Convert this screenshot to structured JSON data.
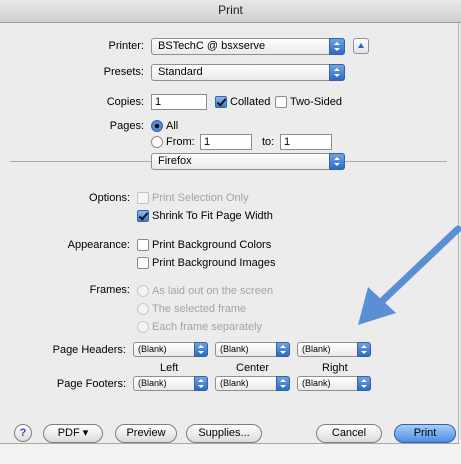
{
  "window": {
    "title": "Print"
  },
  "printer": {
    "label": "Printer:",
    "value": "BSTechC @ bsxserve"
  },
  "presets": {
    "label": "Presets:",
    "value": "Standard"
  },
  "copies": {
    "label": "Copies:",
    "value": "1",
    "collated_label": "Collated",
    "two_sided_label": "Two-Sided"
  },
  "pages": {
    "label": "Pages:",
    "all_label": "All",
    "from_label": "From:",
    "from_value": "1",
    "to_label": "to:",
    "to_value": "1"
  },
  "section": {
    "value": "Firefox"
  },
  "options": {
    "label": "Options:",
    "print_selection_only": "Print Selection Only",
    "shrink_to_fit": "Shrink To Fit Page Width"
  },
  "appearance": {
    "label": "Appearance:",
    "print_bg_colors": "Print Background Colors",
    "print_bg_images": "Print Background Images"
  },
  "frames": {
    "label": "Frames:",
    "as_laid_out": "As laid out on the screen",
    "selected_frame": "The selected frame",
    "each_frame": "Each frame separately"
  },
  "headers": {
    "label": "Page Headers:",
    "left": "(Blank)",
    "center": "(Blank)",
    "right": "(Blank)"
  },
  "columns": {
    "left": "Left",
    "center": "Center",
    "right": "Right"
  },
  "footers": {
    "label": "Page Footers:",
    "left": "(Blank)",
    "center": "(Blank)",
    "right": "(Blank)"
  },
  "buttons": {
    "help": "?",
    "pdf": "PDF ▾",
    "preview": "Preview",
    "supplies": "Supplies...",
    "cancel": "Cancel",
    "print": "Print"
  },
  "annotation": {
    "arrow_color": "#5b8fd4"
  }
}
